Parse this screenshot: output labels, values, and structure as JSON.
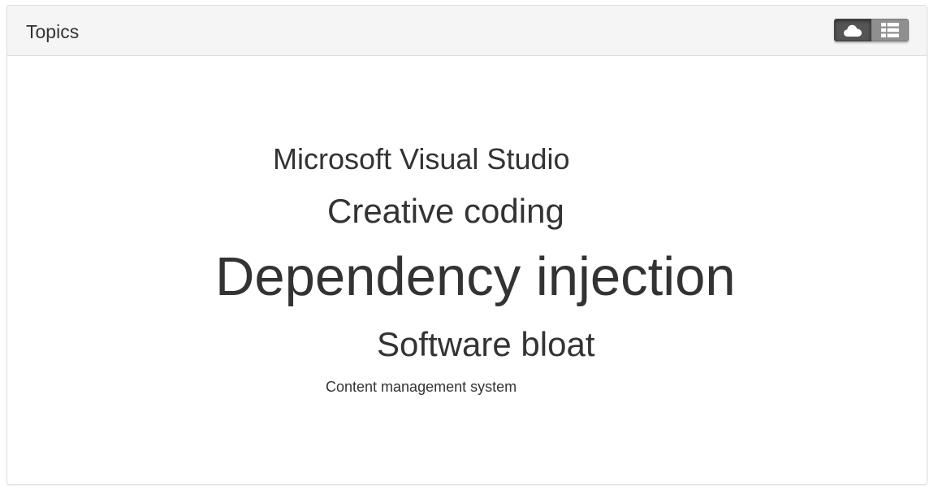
{
  "panel": {
    "title": "Topics"
  },
  "view_toggle": {
    "active": "cloud",
    "options": [
      {
        "name": "cloud",
        "icon": "cloud-icon"
      },
      {
        "name": "list",
        "icon": "list-icon"
      }
    ]
  },
  "word_cloud": {
    "words": [
      {
        "text": "Microsoft Visual Studio"
      },
      {
        "text": "Creative coding"
      },
      {
        "text": "Dependency injection"
      },
      {
        "text": "Software bloat"
      },
      {
        "text": "Content management system"
      }
    ]
  },
  "colors": {
    "text": "#333333",
    "heading_bg": "#f5f5f5",
    "border": "#dddddd",
    "active_button": "#555555",
    "inactive_button": "#8f8f8f"
  }
}
